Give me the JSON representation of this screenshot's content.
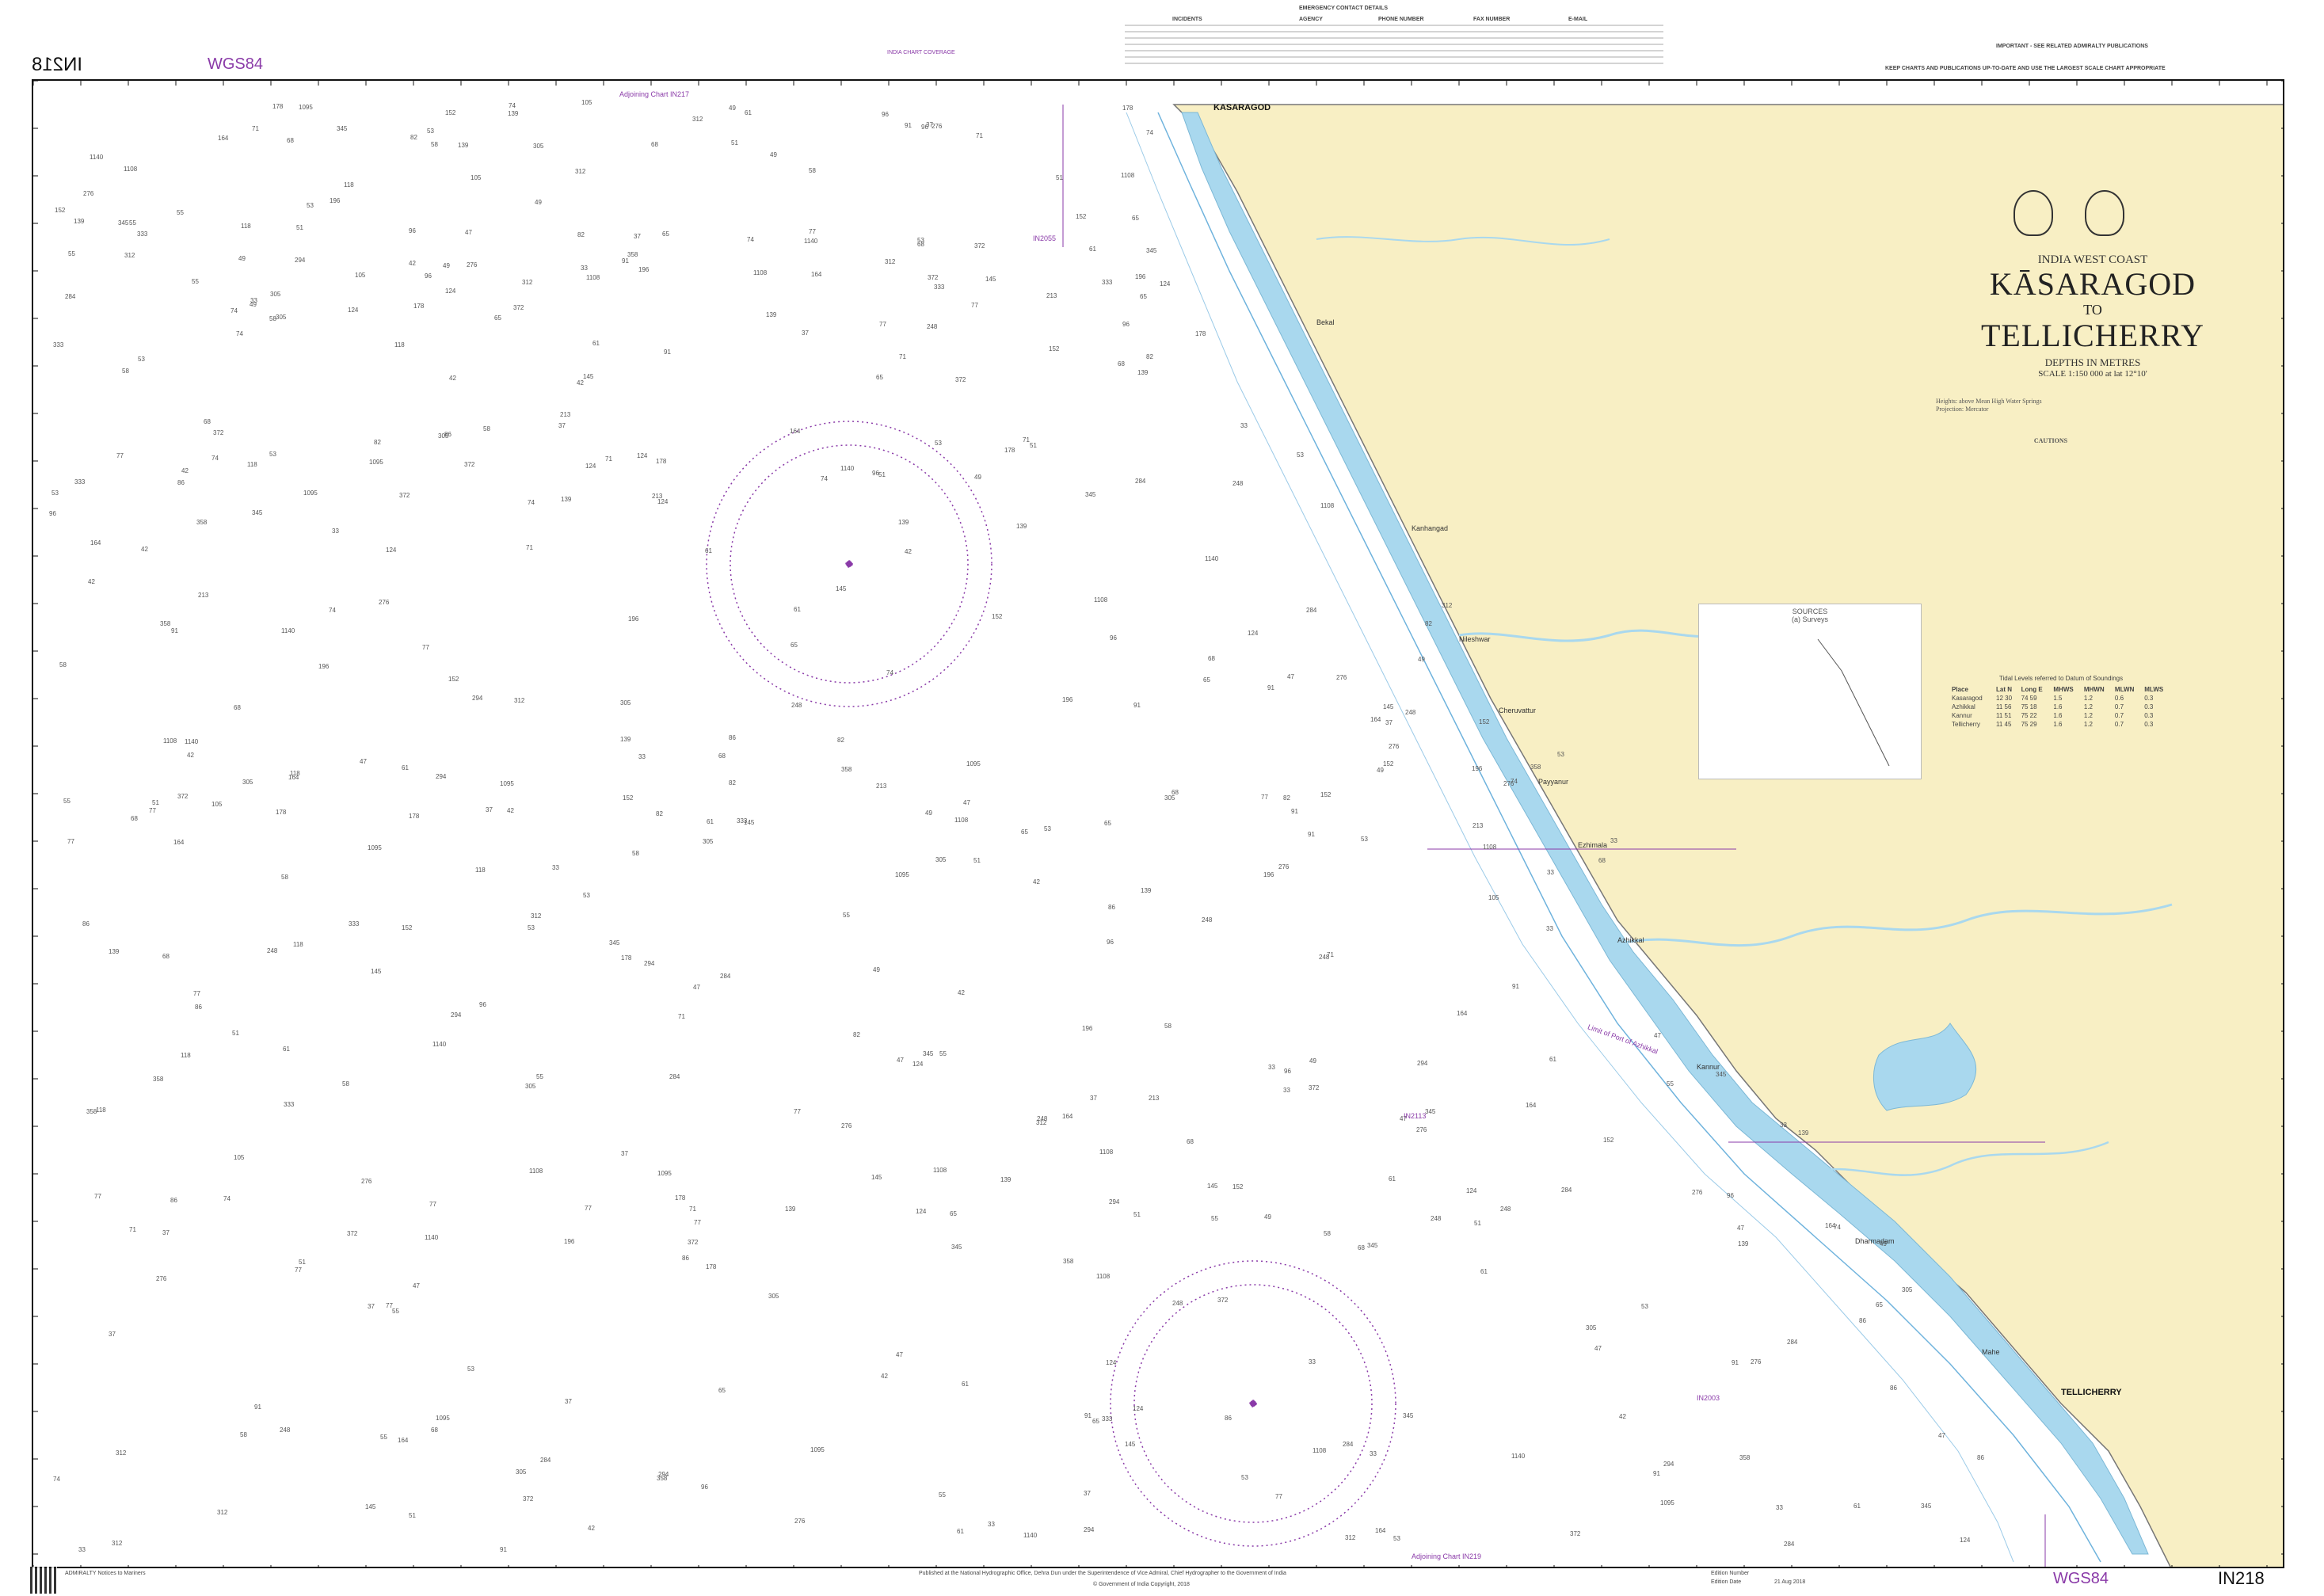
{
  "chart": {
    "number": "IN218",
    "number_mirrored": "IN218",
    "datum": "WGS84",
    "region": "INDIA  WEST COAST",
    "title_line1": "KĀSARAGOD",
    "title_to": "TO",
    "title_line2": "TELLICHERRY",
    "depths": "DEPTHS IN METRES",
    "scale": "SCALE 1:150 000 at lat 12°10'",
    "land_color": "#f8efc4",
    "river_color": "#a9d8ee",
    "border_color": "#111111",
    "label_color": "#8a3aa8"
  },
  "header": {
    "contact_heading": "EMERGENCY CONTACT DETAILS",
    "incidents": "INCIDENTS",
    "agency": "AGENCY",
    "phone": "PHONE NUMBER",
    "fax": "FAX NUMBER",
    "email": "E-MAIL",
    "important": "IMPORTANT - SEE RELATED ADMIRALTY PUBLICATIONS",
    "keep_updated": "KEEP CHARTS AND PUBLICATIONS UP-TO-DATE AND USE THE LARGEST SCALE CHART APPROPRIATE",
    "small_chart": "INDIA CHART COVERAGE"
  },
  "adjoining": {
    "top": "Adjoining Chart IN217",
    "bottom": "Adjoining Chart IN219",
    "line_of_port": "Limit of Port of Azhikkal",
    "in2055": "IN2055",
    "in2113": "IN2113",
    "in2003": "IN2003"
  },
  "places": [
    {
      "name": "KASARAGOD",
      "big": true
    },
    {
      "name": "TELLICHERRY",
      "big": true
    },
    {
      "name": "Bekal",
      "big": false
    },
    {
      "name": "Kanhangad",
      "big": false
    },
    {
      "name": "Nileshwar",
      "big": false
    },
    {
      "name": "Cheruvattur",
      "big": false
    },
    {
      "name": "Payyanur",
      "big": false
    },
    {
      "name": "Ezhimala",
      "big": false
    },
    {
      "name": "Azhikkal",
      "big": false
    },
    {
      "name": "Kannur",
      "big": false
    },
    {
      "name": "Dharmadam",
      "big": false
    },
    {
      "name": "Mahe",
      "big": false
    }
  ],
  "sources": {
    "title": "SOURCES",
    "subtitle": "(a) Surveys"
  },
  "notes": {
    "heights": "Heights: above Mean High Water Springs",
    "projection": "Projection: Mercator",
    "cautions": "CAUTIONS",
    "tidal_heading": "Tidal Levels referred to Datum of Soundings"
  },
  "tide": {
    "headers": [
      "Place",
      "Lat N",
      "Long E",
      "MHWS",
      "MHWN",
      "MLWN",
      "MLWS"
    ],
    "rows": [
      [
        "Kasaragod",
        "12 30",
        "74 59",
        "1.5",
        "1.2",
        "0.6",
        "0.3"
      ],
      [
        "Azhikkal",
        "11 56",
        "75 18",
        "1.6",
        "1.2",
        "0.7",
        "0.3"
      ],
      [
        "Kannur",
        "11 51",
        "75 22",
        "1.6",
        "1.2",
        "0.7",
        "0.3"
      ],
      [
        "Tellicherry",
        "11 45",
        "75 29",
        "1.6",
        "1.2",
        "0.7",
        "0.3"
      ]
    ]
  },
  "footer": {
    "left": "ADMIRALTY Notices to Mariners",
    "published": "Published at the National Hydrographic Office, Dehra Dun under the Superintendence of Vice Admiral, Chief Hydrographer to the Government of India",
    "copyright": "© Government of India Copyright, 2018",
    "edition": "Edition Number",
    "edition_date": "Edition Date",
    "date_value": "21 Aug 2018"
  },
  "soundings": [
    "33",
    "37",
    "42",
    "47",
    "49",
    "51",
    "53",
    "55",
    "58",
    "61",
    "65",
    "68",
    "71",
    "74",
    "77",
    "82",
    "86",
    "91",
    "96",
    "105",
    "118",
    "124",
    "139",
    "145",
    "152",
    "164",
    "178",
    "196",
    "213",
    "248",
    "276",
    "284",
    "294",
    "305",
    "312",
    "333",
    "345",
    "358",
    "372",
    "1095",
    "1108",
    "1140"
  ]
}
